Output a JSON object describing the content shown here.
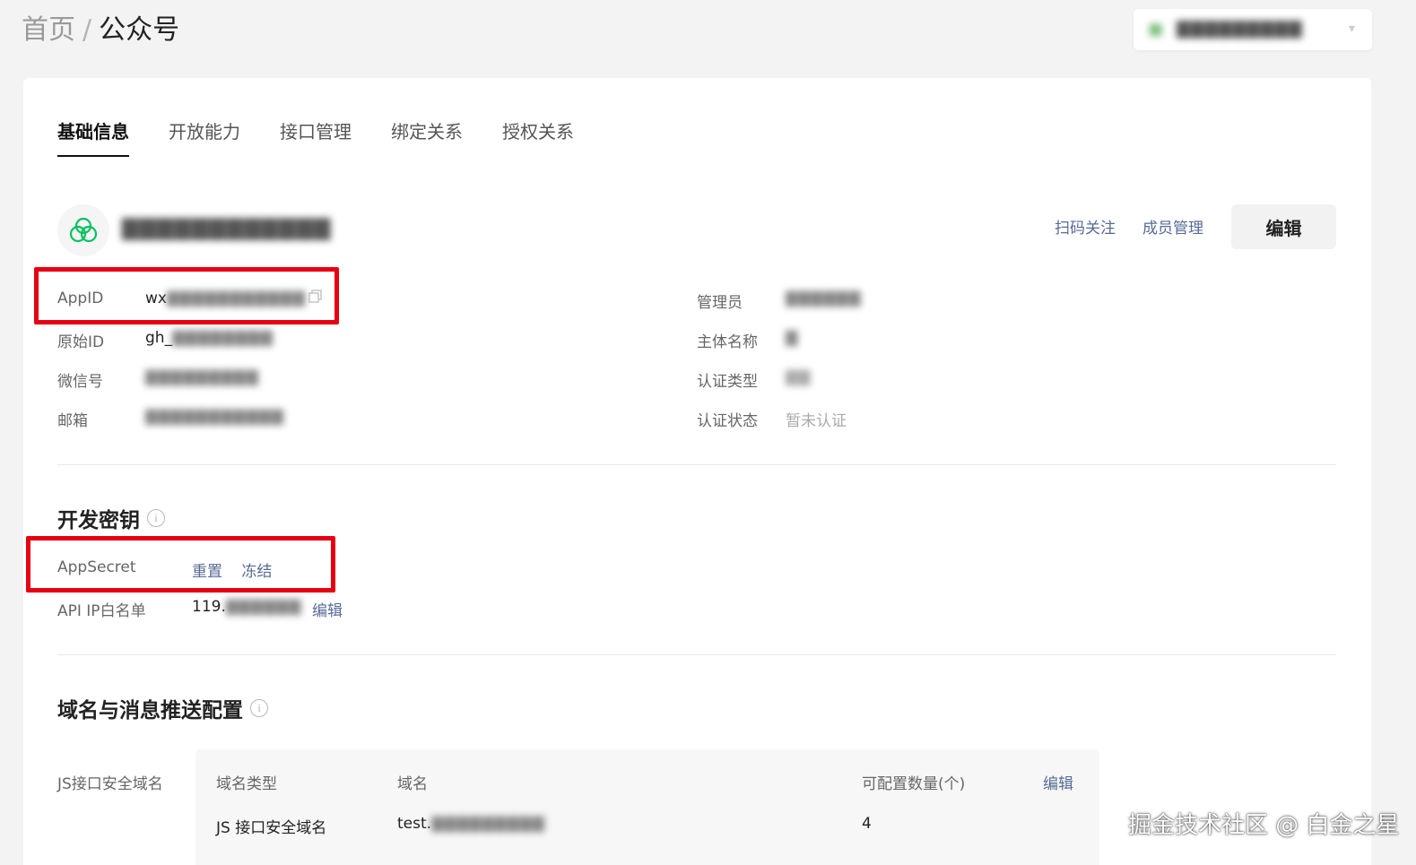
{
  "breadcrumb": {
    "home": "首页",
    "separator": "/",
    "current": "公众号"
  },
  "account_chip": {
    "text": "▇▇▇▇▇▇▇▇▇"
  },
  "tabs": [
    {
      "label": "基础信息",
      "active": true
    },
    {
      "label": "开放能力",
      "active": false
    },
    {
      "label": "接口管理",
      "active": false
    },
    {
      "label": "绑定关系",
      "active": false
    },
    {
      "label": "授权关系",
      "active": false
    }
  ],
  "profile": {
    "name": "▇▇▇▇▇▇▇▇▇▇▇▇",
    "links": {
      "scan_follow": "扫码关注",
      "member_manage": "成员管理"
    },
    "edit_label": "编辑"
  },
  "basic_info": {
    "left": [
      {
        "label": "AppID",
        "value_prefix": "wx",
        "value_blurred": "▇▇▇▇▇▇▇▇▇▇▇"
      },
      {
        "label": "原始ID",
        "value_prefix": "gh_",
        "value_blurred": "▇▇▇▇▇▇▇▇"
      },
      {
        "label": "微信号",
        "value_prefix": "",
        "value_blurred": "▇▇▇▇▇▇▇▇▇"
      },
      {
        "label": "邮箱",
        "value_prefix": "",
        "value_blurred": "▇▇▇▇▇▇▇▇▇▇▇"
      }
    ],
    "right": [
      {
        "label": "管理员",
        "value": "▇▇▇▇▇▇"
      },
      {
        "label": "主体名称",
        "value": "▇"
      },
      {
        "label": "认证类型",
        "value": "▇▇"
      },
      {
        "label": "认证状态",
        "value": "暂未认证"
      }
    ]
  },
  "dev_secret": {
    "title": "开发密钥",
    "appsecret": {
      "label": "AppSecret",
      "reset": "重置",
      "freeze": "冻结"
    },
    "ip_whitelist": {
      "label": "API IP白名单",
      "value_prefix": "119.",
      "value_blurred": "▇▇▇▇▇▇",
      "edit": "编辑"
    }
  },
  "domain_config": {
    "title": "域名与消息推送配置",
    "row_label": "JS接口安全域名",
    "table": {
      "headers": {
        "type": "域名类型",
        "domain": "域名",
        "count": "可配置数量(个)",
        "edit": "编辑"
      },
      "row": {
        "type": "JS 接口安全域名",
        "domain_prefix": "test.",
        "domain_blurred": "▇▇▇▇▇▇▇▇▇",
        "count": "4"
      }
    }
  },
  "watermark": "掘金技术社区 @ 白金之星",
  "colors": {
    "link": "#576b95",
    "highlight": "#e60012",
    "wechat_green": "#07c160"
  }
}
